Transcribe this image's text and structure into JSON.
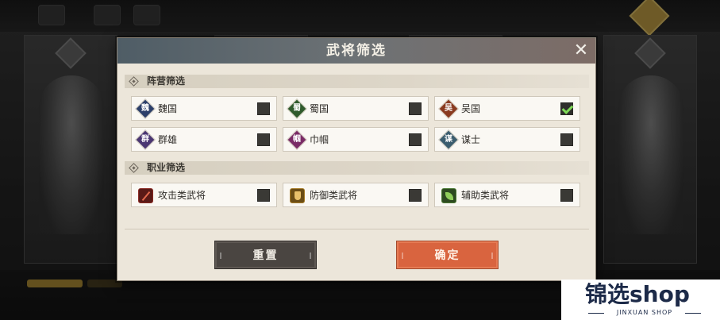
{
  "dialog": {
    "title": "武将筛选",
    "close_glyph": "✕"
  },
  "faction_section": {
    "label": "阵营筛选",
    "options": [
      {
        "badge": "魏",
        "label": "魏国",
        "color": "#2c3f6a",
        "checked": false
      },
      {
        "badge": "蜀",
        "label": "蜀国",
        "color": "#2f5a2c",
        "checked": false
      },
      {
        "badge": "吴",
        "label": "吴国",
        "color": "#8a3a1f",
        "checked": true
      },
      {
        "badge": "群",
        "label": "群雄",
        "color": "#4a3672",
        "checked": false
      },
      {
        "badge": "帼",
        "label": "巾帼",
        "color": "#7a2b66",
        "checked": false
      },
      {
        "badge": "谋",
        "label": "谋士",
        "color": "#3b5d6e",
        "checked": false
      }
    ]
  },
  "role_section": {
    "label": "职业筛选",
    "options": [
      {
        "icon": "attack-icon",
        "label": "攻击类武将",
        "checked": false
      },
      {
        "icon": "shield-icon",
        "label": "防御类武将",
        "checked": false
      },
      {
        "icon": "leaf-icon",
        "label": "辅助类武将",
        "checked": false
      }
    ]
  },
  "buttons": {
    "reset": "重置",
    "confirm": "确定"
  },
  "watermark": {
    "main": "锦选shop",
    "sub": "JINXUAN SHOP"
  },
  "colors": {
    "confirm_button": "#d9643f",
    "reset_button": "#4a4541",
    "check_mark": "#7ed957",
    "dialog_bg": "#ece6da"
  }
}
